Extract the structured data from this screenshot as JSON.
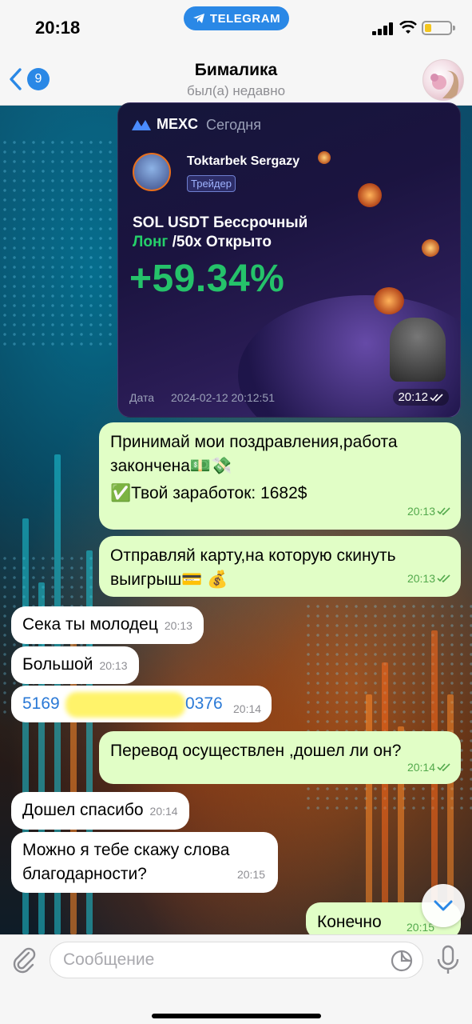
{
  "status_bar": {
    "time": "20:18",
    "app_pill": "TELEGRAM"
  },
  "header": {
    "back_badge": "9",
    "title": "Бималика",
    "subtitle": "был(а) недавно"
  },
  "image_card": {
    "exchange": "MEXC",
    "day": "Сегодня",
    "trader_name": "Toktarbek Sergazy",
    "trader_tag": "Трейдер",
    "pair_line1": "SOL USDT Бессрочный",
    "long_label": "Лонг",
    "pair_line2_rest": " /50x Открыто",
    "pnl": "+59.34%",
    "date_label": "Дата",
    "date_value": "2024-02-12 20:12:51",
    "time": "20:12"
  },
  "messages": [
    {
      "dir": "out",
      "line1": "Принимай мои поздравления,работа",
      "line2": "закончена💵💸",
      "line3": "✅Твой заработок: 1682$",
      "time": "20:13"
    },
    {
      "dir": "out",
      "line1": "Отправляй карту,на которую скинуть",
      "line2": "выигрыш💳 💰",
      "time": "20:13"
    },
    {
      "dir": "in",
      "text": "Сека ты молодец",
      "time": "20:13"
    },
    {
      "dir": "in",
      "text": "Большой",
      "time": "20:13"
    },
    {
      "dir": "in",
      "text_start": "5169",
      "text_end": "0376",
      "time": "20:14"
    },
    {
      "dir": "out",
      "text": "Перевод осуществлен ,дошел ли он?",
      "time": "20:14"
    },
    {
      "dir": "in",
      "text": "Дошел спасибо",
      "time": "20:14"
    },
    {
      "dir": "in",
      "line1": "Можно я тебе скажу слова",
      "line2": "благодарности?",
      "time": "20:15"
    },
    {
      "dir": "out",
      "text": "Конечно",
      "time": "20:15"
    }
  ],
  "input": {
    "placeholder": "Сообщение"
  },
  "icons": {
    "back": "chevron-left-icon",
    "attach": "paperclip-icon",
    "sticker": "sticker-icon",
    "mic": "microphone-icon",
    "scroll": "chevron-down-icon"
  },
  "colors": {
    "accent": "#2a88e6",
    "outgoing_bubble": "#e1fec6",
    "incoming_bubble": "#ffffff",
    "pnl_green": "#25c26a"
  }
}
